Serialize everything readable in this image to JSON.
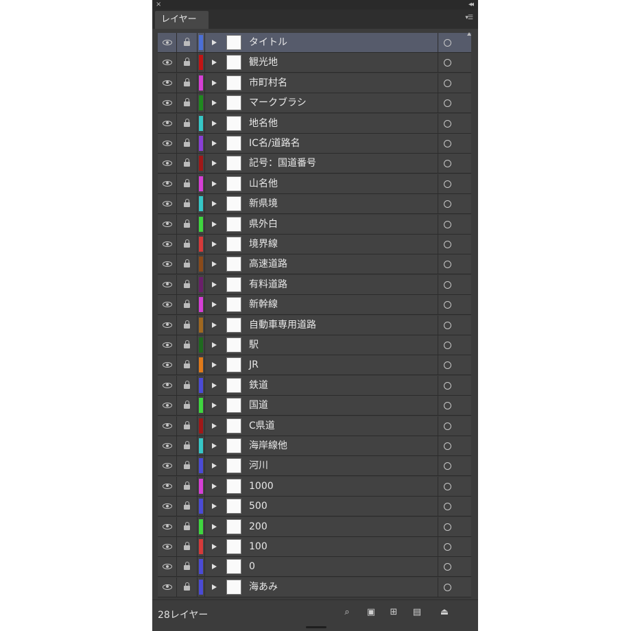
{
  "window": {
    "close_glyph": "×",
    "collapse_glyph": "◂◂"
  },
  "tab": {
    "label": "レイヤー"
  },
  "panel_menu_glyph": "▾☰",
  "layers": [
    {
      "name": "タイトル",
      "color": "#4b6fd6",
      "selected": true
    },
    {
      "name": "観光地",
      "color": "#c21414"
    },
    {
      "name": "市町村名",
      "color": "#d63fd6"
    },
    {
      "name": "マークブラシ",
      "color": "#1f8a1f"
    },
    {
      "name": "地名他",
      "color": "#36c7c7"
    },
    {
      "name": "IC名/道路名",
      "color": "#8a3fd6"
    },
    {
      "name": "記号：国道番号",
      "color": "#a01818"
    },
    {
      "name": "山名他",
      "color": "#d63fd6"
    },
    {
      "name": "新県境",
      "color": "#36c7c7"
    },
    {
      "name": "県外白",
      "color": "#3fd63f"
    },
    {
      "name": "境界線",
      "color": "#d63a3a"
    },
    {
      "name": "高速道路",
      "color": "#8a4a1a"
    },
    {
      "name": "有料道路",
      "color": "#6a1f6a"
    },
    {
      "name": "新幹線",
      "color": "#d63fd6"
    },
    {
      "name": "自動車専用道路",
      "color": "#a06820"
    },
    {
      "name": "駅",
      "color": "#1f6a1f"
    },
    {
      "name": "JR",
      "color": "#e07a1a"
    },
    {
      "name": "鉄道",
      "color": "#4b4bd6"
    },
    {
      "name": "国道",
      "color": "#3fd63f"
    },
    {
      "name": "C県道",
      "color": "#a01818"
    },
    {
      "name": "海岸線他",
      "color": "#36c7c7"
    },
    {
      "name": "河川",
      "color": "#4b4bd6"
    },
    {
      "name": "1000",
      "color": "#d63fd6"
    },
    {
      "name": "500",
      "color": "#4b4bd6"
    },
    {
      "name": "200",
      "color": "#3fd63f"
    },
    {
      "name": "100",
      "color": "#d63a3a"
    },
    {
      "name": "0",
      "color": "#4b4bd6"
    },
    {
      "name": "海あみ",
      "color": "#4b4bd6"
    }
  ],
  "footer": {
    "layer_count": "28レイヤー",
    "buttons": [
      {
        "name": "locate-object-button",
        "glyph": "⌕"
      },
      {
        "name": "make-clipping-mask-button",
        "glyph": "▣"
      },
      {
        "name": "create-sublayer-button",
        "glyph": "⊞"
      },
      {
        "name": "create-new-layer-button",
        "glyph": "▤"
      },
      {
        "name": "delete-layer-button",
        "glyph": "⏏"
      }
    ]
  }
}
